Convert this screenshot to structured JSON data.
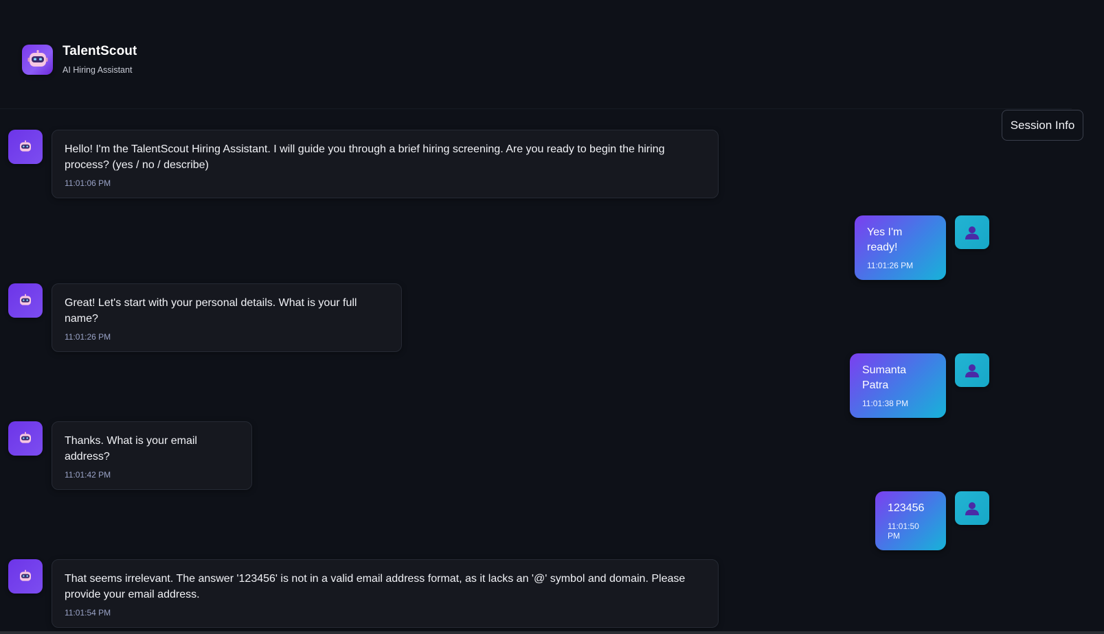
{
  "header": {
    "title": "TalentScout",
    "subtitle": "AI Hiring Assistant"
  },
  "session_button": {
    "label": "Session Info"
  },
  "icons": {
    "bot": "robot-icon",
    "user": "user-icon"
  },
  "colors": {
    "background": "#0e1118",
    "bot_bubble": "#16181f",
    "bot_avatar": "#6d35e8",
    "user_avatar": "#22b3d3",
    "user_gradient_start": "#7b3ff0",
    "user_gradient_end": "#17b3d8",
    "timestamp": "#9aa3c7"
  },
  "messages": [
    {
      "role": "bot",
      "text": "Hello! I'm the TalentScout Hiring Assistant. I will guide you through a brief hiring screening. Are you ready to begin the hiring process? (yes / no / describe)",
      "time": "11:01:06 PM"
    },
    {
      "role": "user",
      "text": "Yes I'm ready!",
      "time": "11:01:26 PM"
    },
    {
      "role": "bot",
      "text": "Great! Let's start with your personal details. What is your full name?",
      "time": "11:01:26 PM"
    },
    {
      "role": "user",
      "text": "Sumanta Patra",
      "time": "11:01:38 PM"
    },
    {
      "role": "bot",
      "text": "Thanks. What is your email address?",
      "time": "11:01:42 PM"
    },
    {
      "role": "user",
      "text": "123456",
      "time": "11:01:50 PM"
    },
    {
      "role": "bot",
      "text": "That seems irrelevant. The answer '123456' is not in a valid email address format, as it lacks an '@' symbol and domain. Please provide your email address.",
      "time": "11:01:54 PM"
    }
  ]
}
